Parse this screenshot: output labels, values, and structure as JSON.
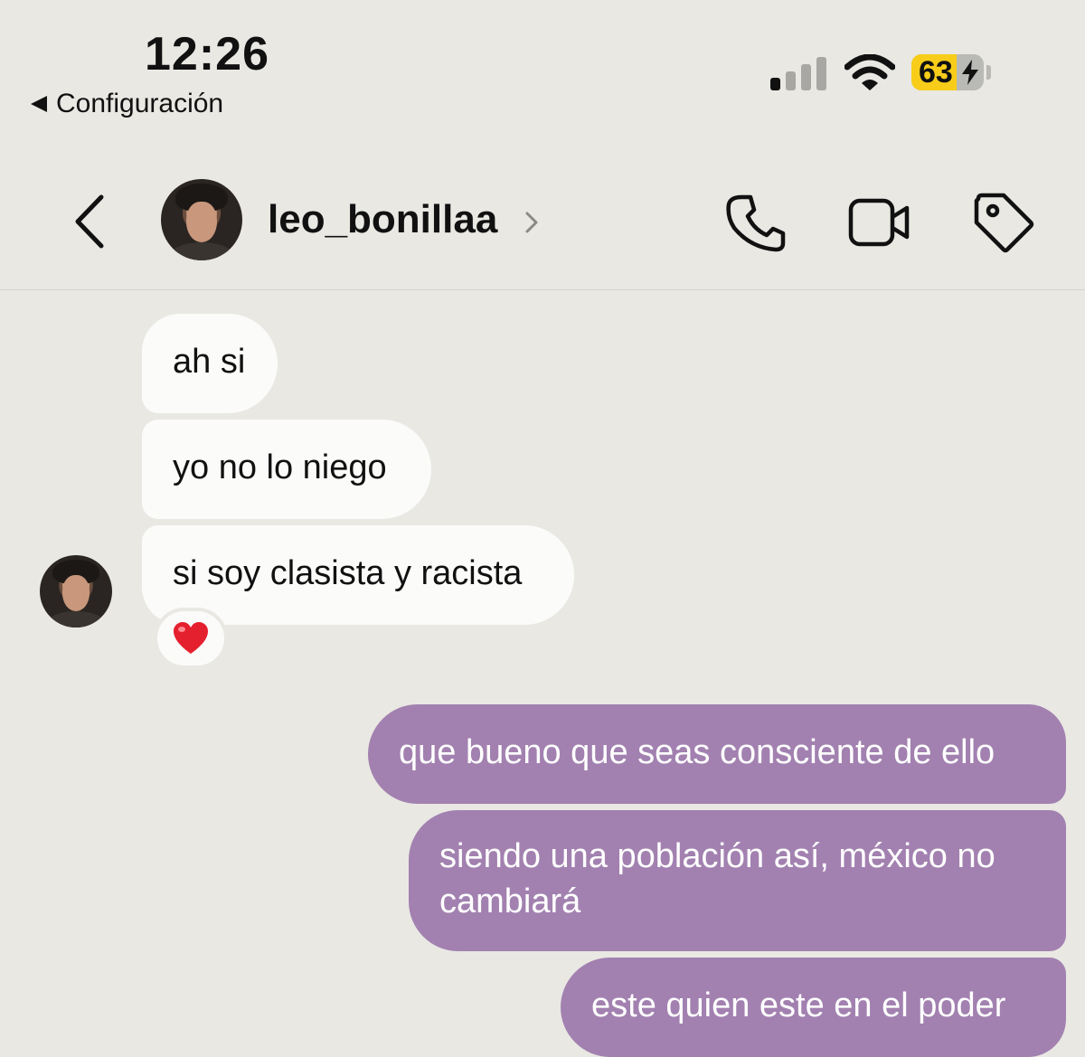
{
  "status_bar": {
    "time": "12:26",
    "back_app_label": "Configuración",
    "battery_percent": "63",
    "battery_level": 0.63,
    "signal_bars_active": 1
  },
  "header": {
    "username": "leo_bonillaa"
  },
  "reaction": "❤️",
  "messages": [
    {
      "from": "them",
      "text": "ah si"
    },
    {
      "from": "them",
      "text": "yo no lo niego"
    },
    {
      "from": "them",
      "text": "si soy clasista y racista"
    },
    {
      "from": "me",
      "text": "que bueno que seas consciente de ello"
    },
    {
      "from": "me",
      "lines": [
        "siendo una población así, méxico no",
        "cambiará"
      ]
    },
    {
      "from": "me",
      "text": "este quien este en el poder"
    }
  ],
  "colors": {
    "background": "#e9e8e3",
    "incoming_bubble": "#fbfbfa",
    "outgoing_bubble": "#a281b0",
    "battery_fill": "#f7cd1a"
  },
  "icons": [
    "back-triangle-icon",
    "signal-icon",
    "wifi-icon",
    "battery-icon",
    "bolt-icon",
    "back-chevron-icon",
    "chevron-right-icon",
    "phone-icon",
    "video-icon",
    "tag-icon",
    "heart-icon"
  ]
}
